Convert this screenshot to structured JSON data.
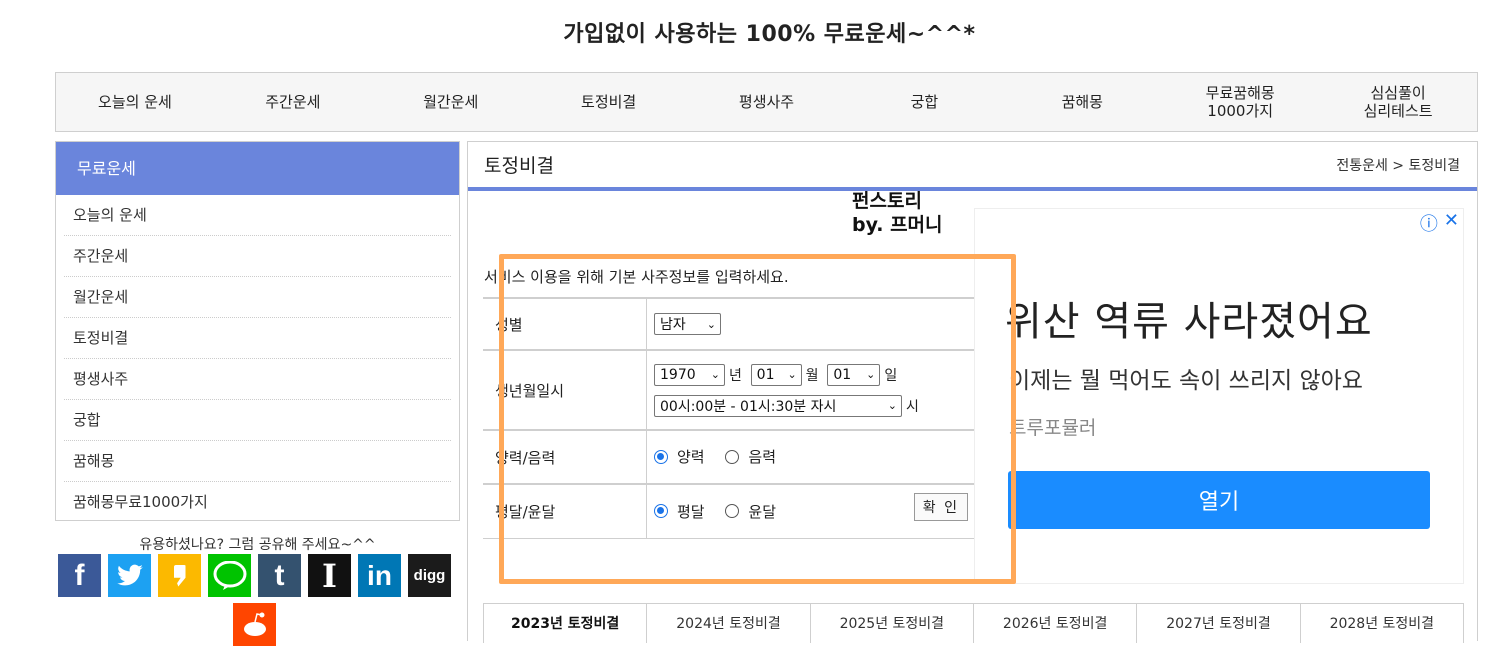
{
  "site_title": "가입없이 사용하는 100% 무료운세~^^*",
  "nav": [
    "오늘의 운세",
    "주간운세",
    "월간운세",
    "토정비결",
    "평생사주",
    "궁합",
    "꿈해몽",
    "무료꿈해몽\n1000가지",
    "심심풀이\n심리테스트"
  ],
  "sidebar": {
    "heading": "무료운세",
    "items": [
      "오늘의 운세",
      "주간운세",
      "월간운세",
      "토정비결",
      "평생사주",
      "궁합",
      "꿈해몽",
      "꿈해몽무료1000가지"
    ]
  },
  "share": {
    "text": "유용하셨나요? 그럼 공유해 주세요~^^",
    "buttons": [
      {
        "name": "facebook",
        "glyph": "f",
        "color": "#3b5998"
      },
      {
        "name": "twitter",
        "glyph": "🐦",
        "color": "#1da1f2"
      },
      {
        "name": "kakaostory",
        "glyph": "❟",
        "color": "#fcb900"
      },
      {
        "name": "line",
        "glyph": "LINE",
        "color": "#00c300"
      },
      {
        "name": "tumblr",
        "glyph": "t",
        "color": "#34526f"
      },
      {
        "name": "instapaper",
        "glyph": "I",
        "color": "#111111"
      },
      {
        "name": "linkedin",
        "glyph": "in",
        "color": "#0077b5"
      },
      {
        "name": "digg",
        "glyph": "digg",
        "color": "#1b1b1b"
      }
    ]
  },
  "content": {
    "title": "토정비결",
    "breadcrumb": "전통운세 > 토정비결",
    "brand_line1": "펀스토리",
    "brand_line2": "by. 프머니",
    "intro": "서비스 이용을 위해 기본 사주정보를 입력하세요."
  },
  "form": {
    "gender_label": "성별",
    "gender_value": "남자",
    "birth_label": "생년월일시",
    "year": "1970",
    "year_unit": "년",
    "month": "01",
    "month_unit": "월",
    "day": "01",
    "day_unit": "일",
    "time": "00시:00분 - 01시:30분 자시",
    "time_unit": "시",
    "calendar_label": "양력/음력",
    "calendar_opt1": "양력",
    "calendar_opt2": "음력",
    "leap_label": "평달/윤달",
    "leap_opt1": "평달",
    "leap_opt2": "윤달",
    "confirm": "확 인"
  },
  "ad": {
    "headline": "위산 역류 사라졌어요",
    "sub": "이제는 뭘 먹어도 속이 쓰리지 않아요",
    "source": "트루포뮬러",
    "button": "열기"
  },
  "year_tabs": [
    "2023년 토정비결",
    "2024년 토정비결",
    "2025년 토정비결",
    "2026년 토정비결",
    "2027년 토정비결",
    "2028년 토정비결"
  ]
}
